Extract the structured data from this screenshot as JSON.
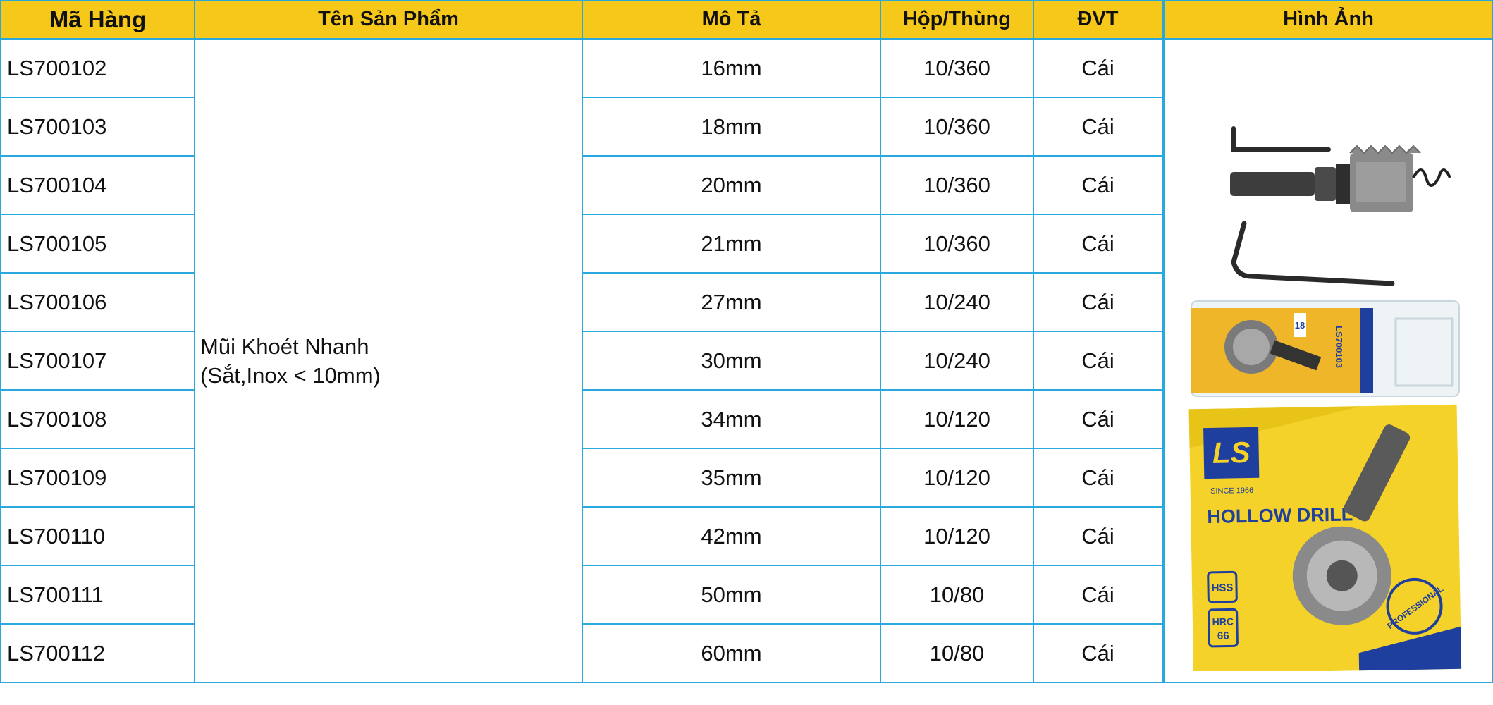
{
  "headers": {
    "code": "Mã Hàng",
    "name": "Tên Sản Phẩm",
    "description": "Mô Tả",
    "pack": "Hộp/Thùng",
    "unit": "ĐVT",
    "image": "Hình Ảnh"
  },
  "product_name": {
    "line1": "Mũi Khoét Nhanh",
    "line2": "(Sắt,Inox < 10mm)"
  },
  "rows": [
    {
      "code": "LS700102",
      "description": "16mm",
      "pack": "10/360",
      "unit": "Cái"
    },
    {
      "code": "LS700103",
      "description": "18mm",
      "pack": "10/360",
      "unit": "Cái"
    },
    {
      "code": "LS700104",
      "description": "20mm",
      "pack": "10/360",
      "unit": "Cái"
    },
    {
      "code": "LS700105",
      "description": "21mm",
      "pack": "10/360",
      "unit": "Cái"
    },
    {
      "code": "LS700106",
      "description": "27mm",
      "pack": "10/240",
      "unit": "Cái"
    },
    {
      "code": "LS700107",
      "description": "30mm",
      "pack": "10/240",
      "unit": "Cái"
    },
    {
      "code": "LS700108",
      "description": "34mm",
      "pack": "10/120",
      "unit": "Cái"
    },
    {
      "code": "LS700109",
      "description": "35mm",
      "pack": "10/120",
      "unit": "Cái"
    },
    {
      "code": "LS700110",
      "description": "42mm",
      "pack": "10/120",
      "unit": "Cái"
    },
    {
      "code": "LS700111",
      "description": "50mm",
      "pack": "10/80",
      "unit": "Cái"
    },
    {
      "code": "LS700112",
      "description": "60mm",
      "pack": "10/80",
      "unit": "Cái"
    }
  ],
  "product_image": {
    "brand_mark": "LS",
    "box_title": "HOLLOW DRILL",
    "since": "SINCE 1966",
    "badge_material": "HSS",
    "badge_hardness_line1": "HRC",
    "badge_hardness_line2": "66",
    "seal_text": "PROFESSIONAL",
    "package_code": "LS700103",
    "package_size": "18"
  },
  "colors": {
    "header_background": "#f6c81a",
    "grid_line": "#28a8dc",
    "box_yellow": "#f4d22a",
    "box_blue": "#1f3f9e"
  },
  "icons": {
    "product_photo": "hole-saw-drill-bit-icon"
  }
}
